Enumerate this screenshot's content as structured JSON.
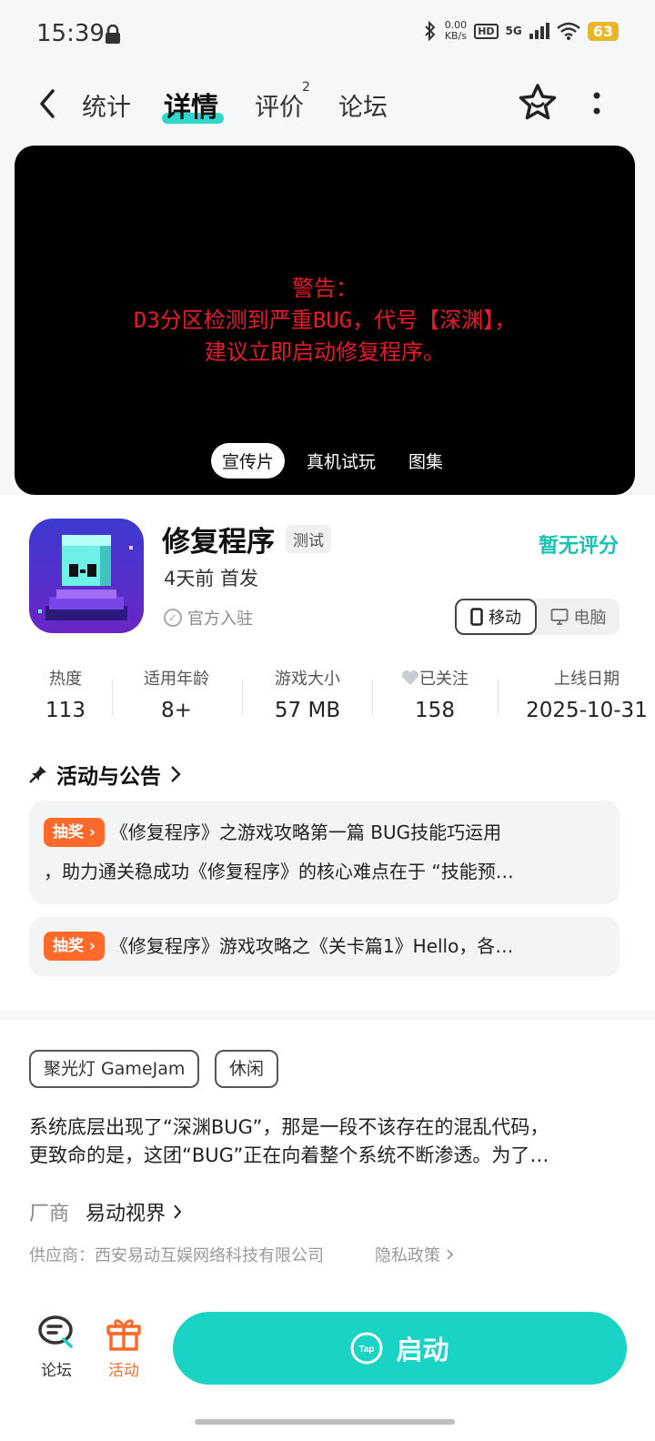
{
  "status_bar": {
    "time": "15:39",
    "speed_value": "0.00",
    "speed_unit": "KB/s",
    "hd": "HD",
    "network": "5G",
    "battery": "63"
  },
  "header": {
    "tabs": [
      {
        "label": "统计"
      },
      {
        "label": "详情"
      },
      {
        "label": "评价"
      },
      {
        "label": "论坛"
      }
    ],
    "active_tab": "详情",
    "review_badge": "2"
  },
  "video": {
    "line1": "警告：",
    "line2": "D3分区检测到严重BUG，代号【深渊】，",
    "line3": "建议立即启动修复程序。",
    "media_tabs": [
      "宣传片",
      "真机试玩",
      "图集"
    ]
  },
  "app": {
    "name": "修复程序",
    "badge": "测试",
    "release": "4天前 首发",
    "official": "官方入驻",
    "rating": "暂无评分",
    "platforms": [
      "移动",
      "电脑"
    ]
  },
  "stats": [
    {
      "label": "热度",
      "value": "113"
    },
    {
      "label": "适用年龄",
      "value": "8+"
    },
    {
      "label": "游戏大小",
      "value": "57 MB"
    },
    {
      "label": "已关注",
      "value": "158"
    },
    {
      "label": "上线日期",
      "value": "2025-10-31"
    }
  ],
  "announcements": {
    "title": "活动与公告",
    "items": [
      {
        "tag": "抽奖",
        "line1": "《修复程序》之游戏攻略第一篇 BUG技能巧运用",
        "line2": "，助力通关稳成功《修复程序》的核心难点在于 “技能预…"
      },
      {
        "tag": "抽奖",
        "line1": "《修复程序》游戏攻略之《关卡篇1》Hello，各…"
      }
    ]
  },
  "tags": [
    "聚光灯 GameJam",
    "休闲"
  ],
  "description": {
    "line1": "系统底层出现了“深渊BUG”，那是一段不该存在的混乱代码，",
    "line2": "更致命的是，这团“BUG”正在向着整个系统不断渗透。为了…"
  },
  "vendor": {
    "label": "厂商",
    "name": "易动视界"
  },
  "supplier": "供应商：西安易动互娱网络科技有限公司",
  "privacy": "隐私政策",
  "bottom_bar": {
    "forum": "论坛",
    "activity": "活动",
    "launch": "启动",
    "tap_logo": "Tap"
  },
  "colors": {
    "accent": "#19d3c5",
    "lottery": "#ff6a2b",
    "warning": "#e8192c"
  }
}
